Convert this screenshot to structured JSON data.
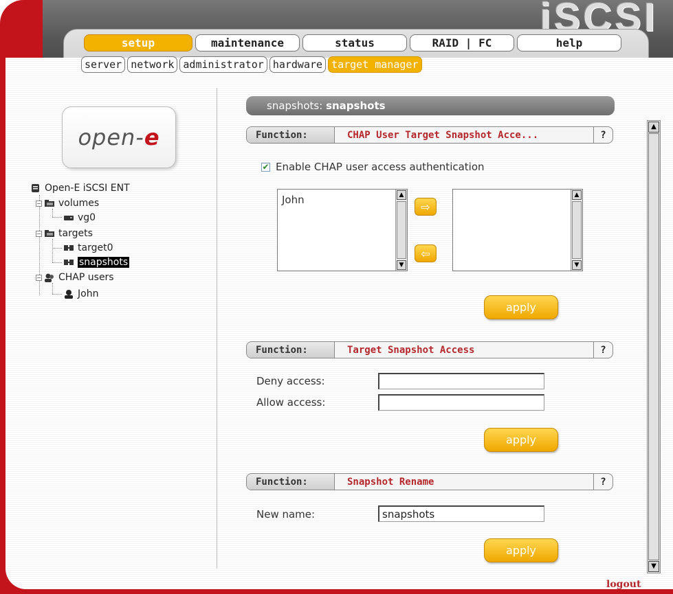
{
  "brand": "iSCSI",
  "logo": {
    "text": "open-",
    "accent": "e"
  },
  "nav": {
    "main_tabs": [
      "setup",
      "maintenance",
      "status",
      "RAID | FC",
      "help"
    ],
    "sub_tabs": [
      "server",
      "network",
      "administrator",
      "hardware",
      "target manager"
    ]
  },
  "tree": {
    "root": "Open-E iSCSI ENT",
    "volumes": "volumes",
    "vg0": "vg0",
    "targets": "targets",
    "target0": "target0",
    "snapshots": "snapshots",
    "chap_users": "CHAP users",
    "john": "John"
  },
  "header": {
    "prefix": "snapshots: ",
    "name": "snapshots"
  },
  "function_label": "Function:",
  "help_glyph": "?",
  "chap": {
    "title": "CHAP User Target Snapshot Acce...",
    "enable_label": "Enable CHAP user access authentication",
    "available_users": [
      "John"
    ],
    "assigned_users": [],
    "apply": "apply"
  },
  "access": {
    "title": "Target Snapshot Access",
    "deny_label": "Deny access:",
    "allow_label": "Allow access:",
    "deny_value": "",
    "allow_value": "",
    "apply": "apply"
  },
  "rename": {
    "title": "Snapshot Rename",
    "new_name_label": "New name:",
    "new_name_value": "snapshots",
    "apply": "apply"
  },
  "logout": "logout",
  "colors": {
    "brand_red": "#c4141b",
    "accent_orange": "#f4b200",
    "title_red": "#b4282d"
  }
}
